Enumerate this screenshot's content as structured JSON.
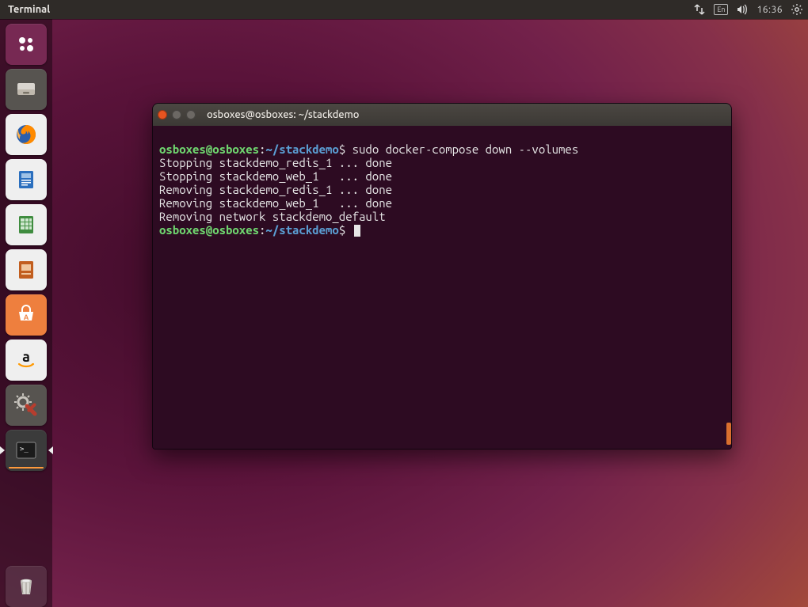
{
  "menubar": {
    "app_name": "Terminal",
    "lang_indicator": "En",
    "clock": "16:36"
  },
  "launcher": {
    "dash_label": "Dash",
    "files_label": "Files",
    "firefox_label": "Firefox",
    "writer_label": "LibreOffice Writer",
    "calc_label": "LibreOffice Calc",
    "impress_label": "LibreOffice Impress",
    "software_label": "Ubuntu Software",
    "amazon_label": "Amazon",
    "settings_label": "System Settings",
    "terminal_label": "Terminal",
    "trash_label": "Trash"
  },
  "terminal": {
    "title": "osboxes@osboxes: ~/stackdemo",
    "prompt_user": "osboxes@osboxes",
    "prompt_sep": ":",
    "prompt_path": "~/stackdemo",
    "prompt_symbol": "$",
    "command": " sudo docker-compose down --volumes",
    "output_line_1": "Stopping stackdemo_redis_1 ... done",
    "output_line_2": "Stopping stackdemo_web_1   ... done",
    "output_line_3": "Removing stackdemo_redis_1 ... done",
    "output_line_4": "Removing stackdemo_web_1   ... done",
    "output_line_5": "Removing network stackdemo_default"
  }
}
